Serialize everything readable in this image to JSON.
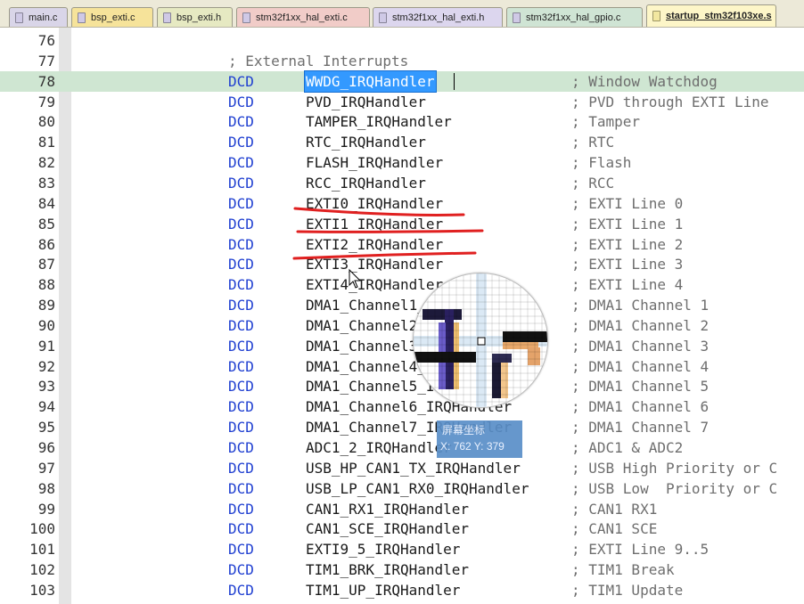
{
  "tabs": [
    {
      "label": "main.c",
      "color": "#d9d5e8",
      "active": false
    },
    {
      "label": "bsp_exti.c",
      "color": "#f6e39a",
      "active": false
    },
    {
      "label": "bsp_exti.h",
      "color": "#e6e9c2",
      "active": false
    },
    {
      "label": "stm32f1xx_hal_exti.c",
      "color": "#f1ccc8",
      "active": false
    },
    {
      "label": "stm32f1xx_hal_exti.h",
      "color": "#dcd6ee",
      "active": false
    },
    {
      "label": "stm32f1xx_hal_gpio.c",
      "color": "#cfe4d4",
      "active": false
    },
    {
      "label": "startup_stm32f103xe.s",
      "color": "#fdf6c8",
      "active": true
    }
  ],
  "editor": {
    "current_line": 78,
    "directive_color": "#1f3fd1",
    "lines": [
      {
        "n": "76",
        "dir": "",
        "label": "",
        "comment": ""
      },
      {
        "n": "77",
        "dir": "",
        "label": "",
        "comment": "",
        "section": "; External Interrupts"
      },
      {
        "n": "78",
        "dir": "DCD",
        "label": "WWDG_IRQHandler",
        "comment": "; Window Watchdog"
      },
      {
        "n": "79",
        "dir": "DCD",
        "label": "PVD_IRQHandler",
        "comment": "; PVD through EXTI Line"
      },
      {
        "n": "80",
        "dir": "DCD",
        "label": "TAMPER_IRQHandler",
        "comment": "; Tamper"
      },
      {
        "n": "81",
        "dir": "DCD",
        "label": "RTC_IRQHandler",
        "comment": "; RTC"
      },
      {
        "n": "82",
        "dir": "DCD",
        "label": "FLASH_IRQHandler",
        "comment": "; Flash"
      },
      {
        "n": "83",
        "dir": "DCD",
        "label": "RCC_IRQHandler",
        "comment": "; RCC"
      },
      {
        "n": "84",
        "dir": "DCD",
        "label": "EXTI0_IRQHandler",
        "comment": "; EXTI Line 0"
      },
      {
        "n": "85",
        "dir": "DCD",
        "label": "EXTI1_IRQHandler",
        "comment": "; EXTI Line 1"
      },
      {
        "n": "86",
        "dir": "DCD",
        "label": "EXTI2_IRQHandler",
        "comment": "; EXTI Line 2"
      },
      {
        "n": "87",
        "dir": "DCD",
        "label": "EXTI3_IRQHandler",
        "comment": "; EXTI Line 3"
      },
      {
        "n": "88",
        "dir": "DCD",
        "label": "EXTI4_IRQHandler",
        "comment": "; EXTI Line 4"
      },
      {
        "n": "89",
        "dir": "DCD",
        "label": "DMA1_Channel1_IRQHandler",
        "comment": "; DMA1 Channel 1"
      },
      {
        "n": "90",
        "dir": "DCD",
        "label": "DMA1_Channel2_IRQHandler",
        "comment": "; DMA1 Channel 2"
      },
      {
        "n": "91",
        "dir": "DCD",
        "label": "DMA1_Channel3_IRQHandler",
        "comment": "; DMA1 Channel 3"
      },
      {
        "n": "92",
        "dir": "DCD",
        "label": "DMA1_Channel4_IRQHandler",
        "comment": "; DMA1 Channel 4"
      },
      {
        "n": "93",
        "dir": "DCD",
        "label": "DMA1_Channel5_IRQHandler",
        "comment": "; DMA1 Channel 5"
      },
      {
        "n": "94",
        "dir": "DCD",
        "label": "DMA1_Channel6_IRQHandler",
        "comment": "; DMA1 Channel 6"
      },
      {
        "n": "95",
        "dir": "DCD",
        "label": "DMA1_Channel7_IRQHandler",
        "comment": "; DMA1 Channel 7"
      },
      {
        "n": "96",
        "dir": "DCD",
        "label": "ADC1_2_IRQHandler",
        "comment": "; ADC1 & ADC2"
      },
      {
        "n": "97",
        "dir": "DCD",
        "label": "USB_HP_CAN1_TX_IRQHandler",
        "comment": "; USB High Priority or C"
      },
      {
        "n": "98",
        "dir": "DCD",
        "label": "USB_LP_CAN1_RX0_IRQHandler",
        "comment": "; USB Low  Priority or C"
      },
      {
        "n": "99",
        "dir": "DCD",
        "label": "CAN1_RX1_IRQHandler",
        "comment": "; CAN1 RX1"
      },
      {
        "n": "100",
        "dir": "DCD",
        "label": "CAN1_SCE_IRQHandler",
        "comment": "; CAN1 SCE"
      },
      {
        "n": "101",
        "dir": "DCD",
        "label": "EXTI9_5_IRQHandler",
        "comment": "; EXTI Line 9..5"
      },
      {
        "n": "102",
        "dir": "DCD",
        "label": "TIM1_BRK_IRQHandler",
        "comment": "; TIM1 Break"
      },
      {
        "n": "103",
        "dir": "DCD",
        "label": "TIM1_UP_IRQHandler",
        "comment": "; TIM1 Update"
      }
    ]
  },
  "annotation": {
    "color": "#e02020"
  },
  "magnifier": {
    "title": "屏幕坐标",
    "coords": "X: 762 Y: 379"
  }
}
